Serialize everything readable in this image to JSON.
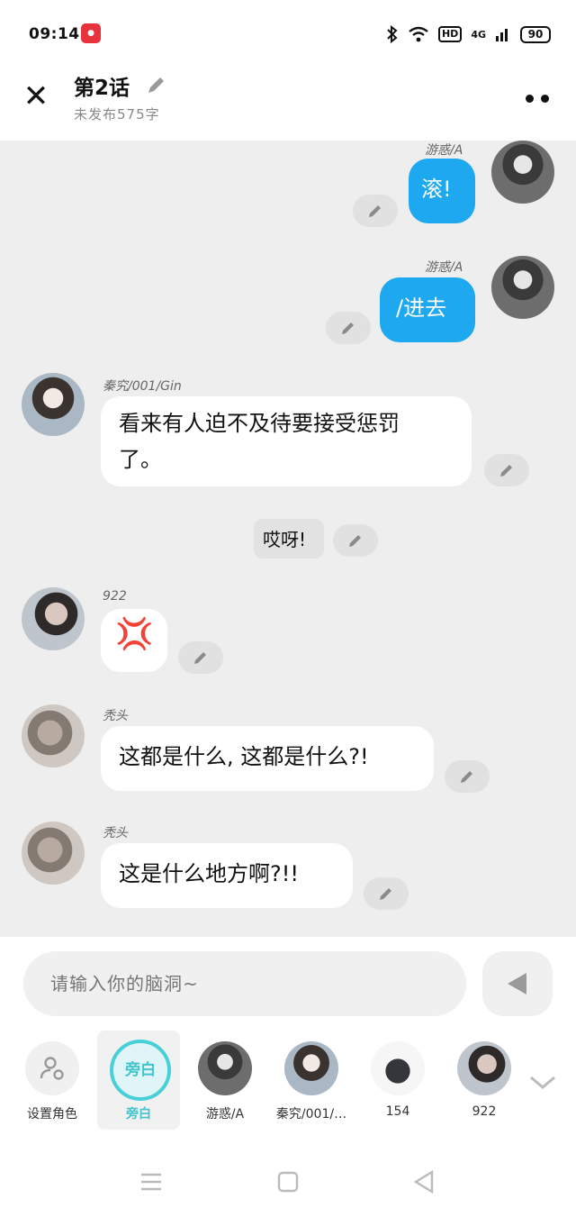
{
  "status": {
    "time": "09:14",
    "hd": "HD",
    "network": "4G",
    "battery": "90"
  },
  "header": {
    "title": "第2话",
    "subtitle": "未发布575字"
  },
  "messages": {
    "m1": {
      "name": "游惑/A",
      "text": "滚!"
    },
    "m2": {
      "name": "游惑/A",
      "text": "/进去"
    },
    "m3": {
      "name": "秦究/001/Gin",
      "line1": "看来有人迫不及待要接受惩罚",
      "line2": "了。"
    },
    "m4": {
      "text": "哎呀!"
    },
    "m5": {
      "name": "922",
      "emoji": "💢"
    },
    "m6": {
      "name": "秃头",
      "text": "这都是什么, 这都是什么?!"
    },
    "m7": {
      "name": "秃头",
      "text": "这是什么地方啊?!!"
    }
  },
  "composer": {
    "placeholder": "请输入你的脑洞~"
  },
  "roles": {
    "set_role": "设置角色",
    "narration": "旁白",
    "narration_label": "旁白",
    "r1": "游惑/A",
    "r2": "秦究/001/…",
    "r3": "154",
    "r4": "922"
  },
  "colors": {
    "accent": "#1ea8f0",
    "narration": "#48d0d8",
    "chat_bg": "#eeeeee"
  }
}
